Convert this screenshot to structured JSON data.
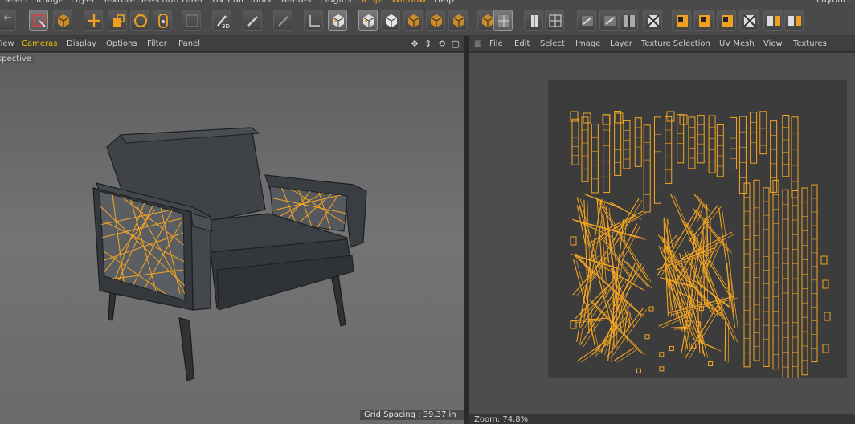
{
  "menubar": {
    "items": [
      {
        "label": "Select",
        "highlight": false
      },
      {
        "label": "Image",
        "highlight": false
      },
      {
        "label": "Layer",
        "highlight": false
      },
      {
        "label": "Texture Selection",
        "highlight": false
      },
      {
        "label": "Filter",
        "highlight": false
      },
      {
        "label": "UV Edit",
        "highlight": false
      },
      {
        "label": "Tools",
        "highlight": false
      },
      {
        "label": "Render",
        "highlight": false
      },
      {
        "label": "Plugins",
        "highlight": false
      },
      {
        "label": "Script",
        "highlight": true
      },
      {
        "label": "Window",
        "highlight": true
      },
      {
        "label": "Help",
        "highlight": false
      },
      {
        "label": "Layout:",
        "highlight": false
      }
    ]
  },
  "toolbar": {
    "icons": [
      "undo-icon",
      "selection-icon",
      "cube-icon",
      "move-icon",
      "scale-icon",
      "rotate-icon",
      "coordinate-icon",
      "filter-icon",
      "paint-3d-icon",
      "brush-icon",
      "polygon-pen-icon",
      "corner-icon",
      "checker-cube-icon",
      "checker-cube-icon",
      "uv-points-icon",
      "cube-icon",
      "cube-icon",
      "cube-icon",
      "cube-icon",
      "uv-grid-icon",
      "uv-relax-icon",
      "uv-layout-icon",
      "uv-map-icon",
      "uv-map-icon",
      "uv-mirror-icon",
      "uv-fit-icon",
      "uv-tile-icon",
      "uv-tile-icon",
      "uv-tile-icon",
      "uv-fit-icon",
      "layout-icon",
      "layout-icon"
    ]
  },
  "viewport": {
    "menu": [
      "View",
      "Cameras",
      "Display",
      "Options",
      "Filter",
      "Panel"
    ],
    "active_menu": "Cameras",
    "projection_label": "Perspective",
    "grid_spacing": "Grid Spacing : 39.37 in",
    "header_icons": "✥ ⇕ ⟲ ▢"
  },
  "uv_editor": {
    "menu": [
      "File",
      "Edit",
      "Select",
      "Image",
      "Layer",
      "Texture Selection",
      "UV Mesh",
      "View",
      "Textures"
    ],
    "zoom": "Zoom: 74.8%"
  },
  "colors": {
    "accent": "#f0a020",
    "wire": "#f5a623",
    "chair": "#3e4044",
    "uv_bg": "#3c3c3c"
  }
}
